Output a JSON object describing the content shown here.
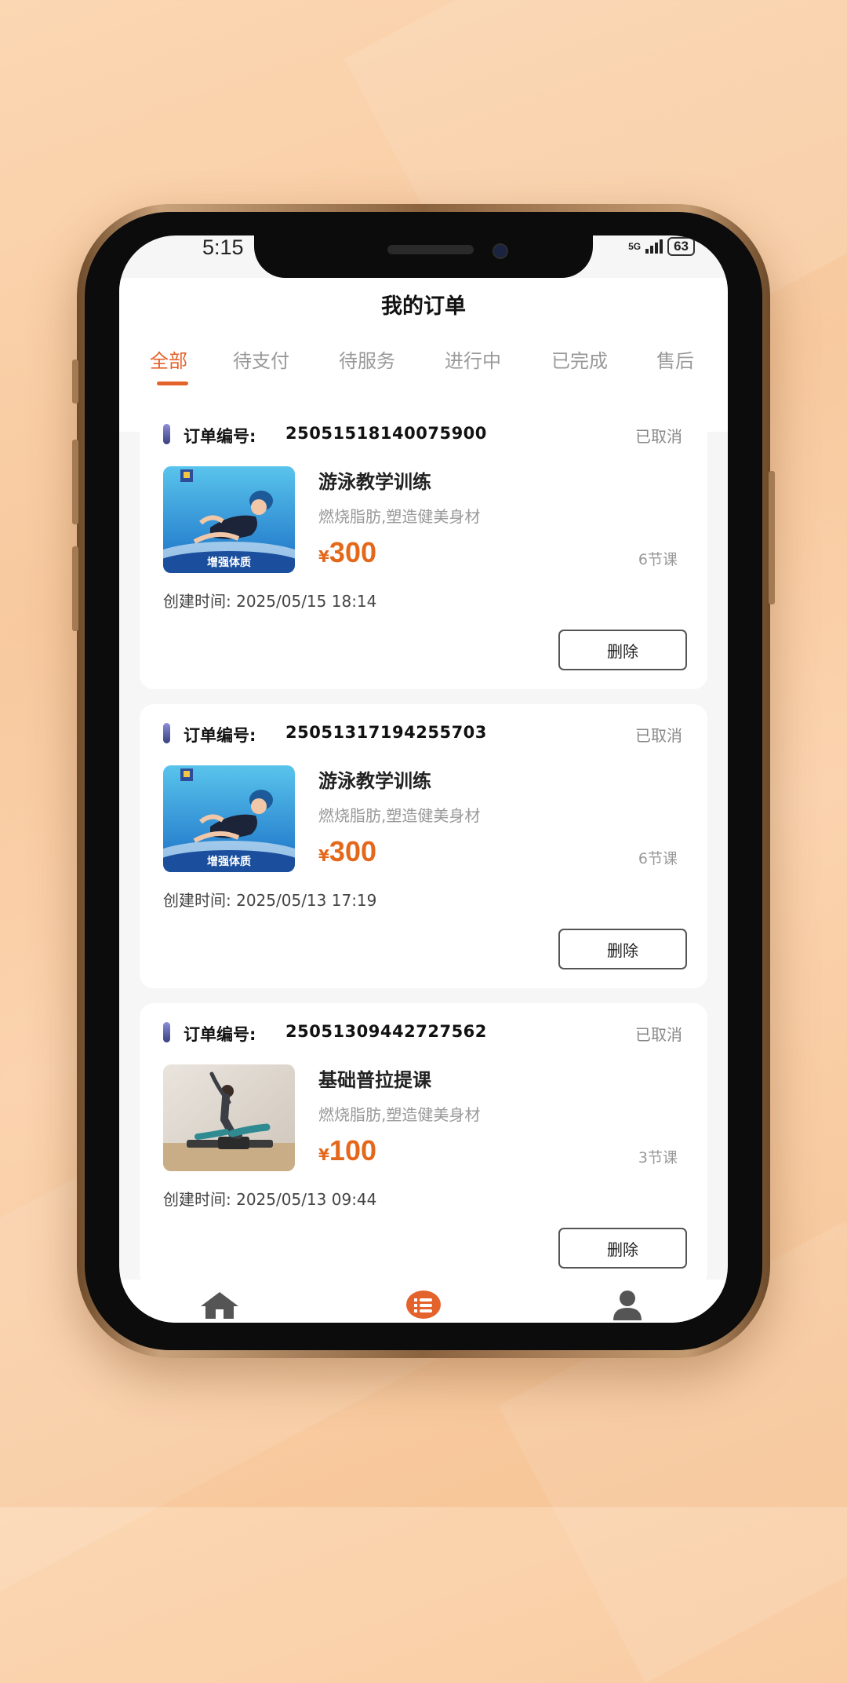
{
  "status_bar": {
    "time": "5:15",
    "network": "5G",
    "battery": "63"
  },
  "header": {
    "title": "我的订单"
  },
  "tabs": [
    {
      "label": "全部",
      "active": true
    },
    {
      "label": "待支付",
      "active": false
    },
    {
      "label": "待服务",
      "active": false
    },
    {
      "label": "进行中",
      "active": false
    },
    {
      "label": "已完成",
      "active": false
    },
    {
      "label": "售后",
      "active": false
    }
  ],
  "orders": [
    {
      "order_label": "订单编号:",
      "order_number": "25051518140075900",
      "status": "已取消",
      "course_name": "游泳教学训练",
      "description": "燃烧脂肪,塑造健美身材",
      "currency": "¥",
      "price": "300",
      "lessons": "6节课",
      "created_label": "创建时间:",
      "created_time": "2025/05/15 18:14",
      "delete_label": "删除",
      "image": "swimming-lesson",
      "image_caption": "增强体质"
    },
    {
      "order_label": "订单编号:",
      "order_number": "25051317194255703",
      "status": "已取消",
      "course_name": "游泳教学训练",
      "description": "燃烧脂肪,塑造健美身材",
      "currency": "¥",
      "price": "300",
      "lessons": "6节课",
      "created_label": "创建时间:",
      "created_time": "2025/05/13 17:19",
      "delete_label": "删除",
      "image": "swimming-lesson",
      "image_caption": "增强体质"
    },
    {
      "order_label": "订单编号:",
      "order_number": "25051309442727562",
      "status": "已取消",
      "course_name": "基础普拉提课",
      "description": "燃烧脂肪,塑造健美身材",
      "currency": "¥",
      "price": "100",
      "lessons": "3节课",
      "created_label": "创建时间:",
      "created_time": "2025/05/13 09:44",
      "delete_label": "删除",
      "image": "pilates-lesson"
    }
  ],
  "bottom_nav": [
    {
      "label": "首页",
      "icon": "home-icon",
      "active": false
    },
    {
      "label": "订单",
      "icon": "order-list-icon",
      "active": true
    },
    {
      "label": "我的",
      "icon": "profile-icon",
      "active": false
    }
  ],
  "colors": {
    "accent": "#e4622b",
    "price": "#e4681b",
    "status": "#888888"
  }
}
